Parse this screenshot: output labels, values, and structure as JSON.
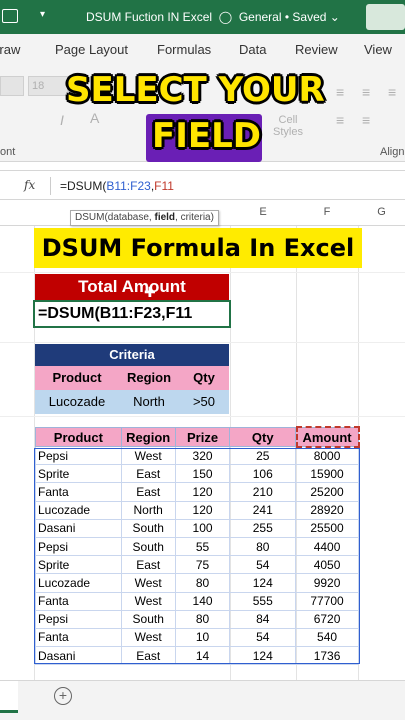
{
  "titlebar": {
    "title": "DSUM Fuction IN Excel",
    "sensitivity": "General",
    "status": "Saved",
    "accent": "#217346"
  },
  "ribbon_tabs": [
    "Draw",
    "Page Layout",
    "Formulas",
    "Data",
    "Review",
    "View"
  ],
  "ribbon": {
    "font_size": "18",
    "group_font": "ont",
    "group_align": "Align",
    "cell_styles": "Cell Styles"
  },
  "overlay": {
    "line1": "SELECT YOUR",
    "line2": "FIELD"
  },
  "formula_bar": {
    "fx": "fx",
    "prefix": "=DSUM(",
    "range": "B11:F23",
    "sep": ",",
    "field": "F11"
  },
  "tooltip": {
    "func": "DSUM(database, ",
    "arg_bold": "field",
    "rest": ", criteria)"
  },
  "columns": [
    "E",
    "F",
    "G"
  ],
  "sheet": {
    "title": "DSUM Formula In Excel",
    "total_header": "Total Amount",
    "formula_cell": {
      "prefix": "=DSUM(",
      "range": "B11:F23",
      "sep": ",",
      "field": "F11"
    }
  },
  "criteria": {
    "header": "Criteria",
    "columns": [
      "Product",
      "Region",
      "Qty"
    ],
    "values": [
      "Lucozade",
      "North",
      ">50"
    ]
  },
  "table": {
    "headers": [
      "Product",
      "Region",
      "Prize",
      "Qty",
      "Amount"
    ],
    "rows": [
      [
        "Pepsi",
        "West",
        "320",
        "25",
        "8000"
      ],
      [
        "Sprite",
        "East",
        "150",
        "106",
        "15900"
      ],
      [
        "Fanta",
        "East",
        "120",
        "210",
        "25200"
      ],
      [
        "Lucozade",
        "North",
        "120",
        "241",
        "28920"
      ],
      [
        "Dasani",
        "South",
        "100",
        "255",
        "25500"
      ],
      [
        "Pepsi",
        "South",
        "55",
        "80",
        "4400"
      ],
      [
        "Sprite",
        "East",
        "75",
        "54",
        "4050"
      ],
      [
        "Lucozade",
        "West",
        "80",
        "124",
        "9920"
      ],
      [
        "Fanta",
        "West",
        "140",
        "555",
        "77700"
      ],
      [
        "Pepsi",
        "South",
        "80",
        "84",
        "6720"
      ],
      [
        "Fanta",
        "West",
        "10",
        "54",
        "540"
      ],
      [
        "Dasani",
        "East",
        "14",
        "124",
        "1736"
      ]
    ]
  },
  "colors": {
    "title_bg": "#ffeb00",
    "total_bg": "#c00000",
    "criteria_hdr": "#1f3b7a",
    "pink": "#f4a6c6",
    "light_blue": "#bdd7ee"
  }
}
